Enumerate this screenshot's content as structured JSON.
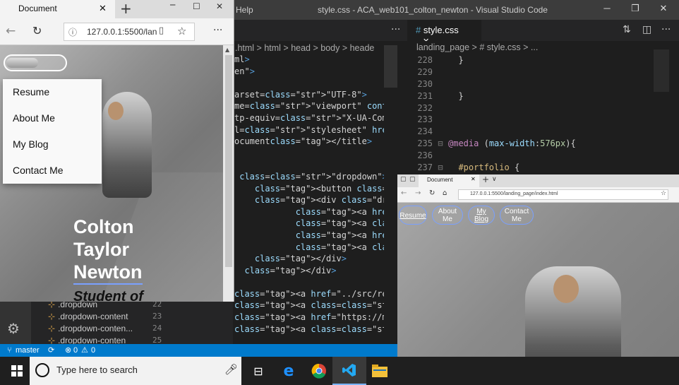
{
  "vscode": {
    "menu_help": "Help",
    "window_title": "style.css - ACA_web101_colton_newton - Visual Studio Code",
    "left_group": {
      "breadcrumb": ".html  > html  > head  > body  > heade",
      "lines": [
        {
          "text": "ml>"
        },
        {
          "text": "en\">"
        },
        {
          "text": ""
        },
        {
          "text": "arset=\"UTF-8\">"
        },
        {
          "text": "me=\"viewport\" content=\"width=,"
        },
        {
          "text": "tp-equiv=\"X-UA-Compatible\" conte"
        },
        {
          "text": "l=\"stylesheet\" href=\"./style.css"
        },
        {
          "text": "ocument</title>"
        },
        {
          "text": ""
        },
        {
          "text": ""
        },
        {
          "text": " class=\"dropdown\">"
        },
        {
          "text": "    <button class=\"dropbtn\"></bu"
        },
        {
          "text": "    <div class=\"dropdown-conten"
        },
        {
          "text": "            <a href=\"../src/resu"
        },
        {
          "text": "            <a class=\"has-border"
        },
        {
          "text": "            <a href=\"https://med"
        },
        {
          "text": "            <a class=\"has-border"
        },
        {
          "text": "    </div>"
        },
        {
          "text": "  </div>"
        },
        {
          "text": ""
        },
        {
          "text": "<a href=\"../src/resume/resume.ht"
        },
        {
          "text": "<a class=\"has-border\">About Me</"
        },
        {
          "text": "<a href=\"https://medium.com/@co"
        },
        {
          "text": "<a class=\"has-border\">Contact Me"
        }
      ]
    },
    "right_group": {
      "tab_label": "style.css",
      "breadcrumb": "landing_page  >  # style.css  > ...",
      "lines": [
        {
          "num": "228",
          "text": "  }"
        },
        {
          "num": "229",
          "text": ""
        },
        {
          "num": "230",
          "text": ""
        },
        {
          "num": "231",
          "text": "  }"
        },
        {
          "num": "232",
          "text": ""
        },
        {
          "num": "233",
          "text": ""
        },
        {
          "num": "234",
          "text": ""
        },
        {
          "num": "235",
          "text": "@media (max-width:576px){"
        },
        {
          "num": "236",
          "text": ""
        },
        {
          "num": "237",
          "text": "  #portfolio {"
        }
      ]
    },
    "outline": {
      "items": [
        ".dropdown",
        ".dropdown-content",
        ".dropdown-conten...",
        ".dropdown-conten"
      ],
      "line_numbers": [
        "22",
        "23",
        "24",
        "25"
      ]
    },
    "status": {
      "branch": "master",
      "errors": "0",
      "warnings": "0"
    }
  },
  "edge": {
    "tab_title": "Document",
    "address": "127.0.0.1:5500/lan",
    "menu_items": [
      "Resume",
      "About Me",
      "My Blog",
      "Contact Me"
    ],
    "hero_name": [
      "Colton",
      "Taylor",
      "Newton"
    ],
    "subtitle": "Student of"
  },
  "right_browser": {
    "tab_title": "Document",
    "address": "127.0.0.1:5500/landing_page/index.html",
    "nav": [
      "Resume",
      "About Me",
      "My Blog",
      "Contact Me"
    ]
  },
  "taskbar": {
    "search_placeholder": "Type here to search"
  }
}
